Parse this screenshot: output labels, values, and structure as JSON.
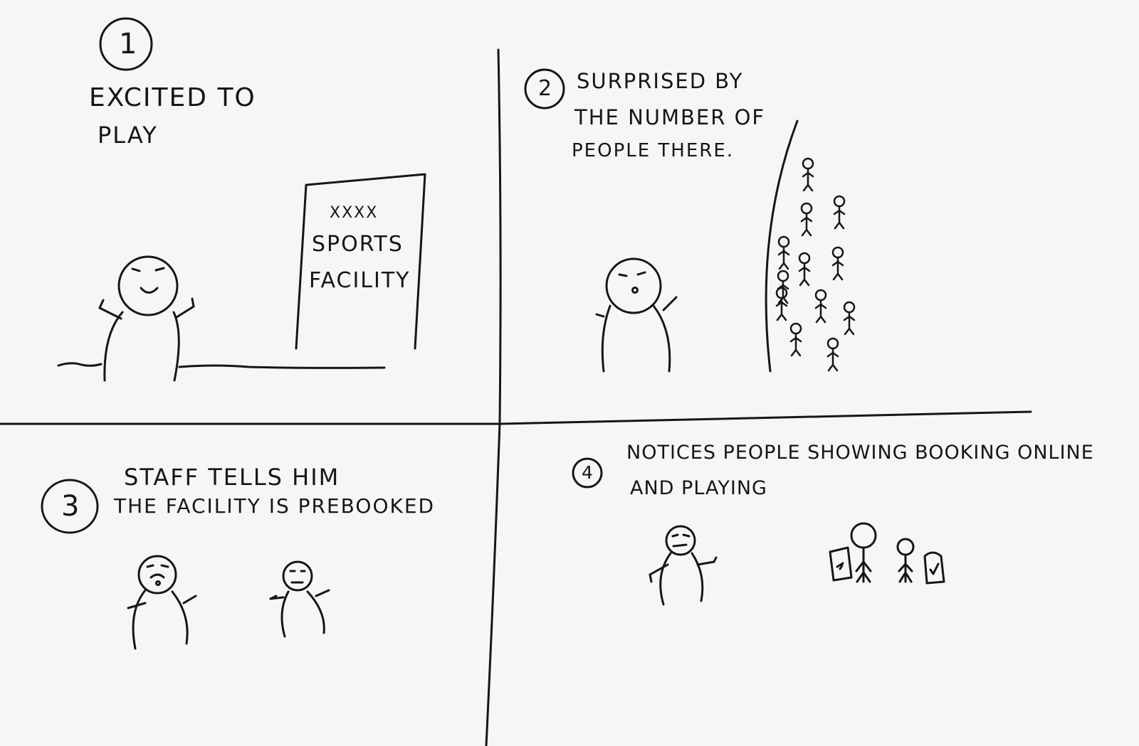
{
  "panels": [
    {
      "number": "1",
      "caption_lines": [
        "EXCITED TO",
        "PLAY"
      ]
    },
    {
      "number": "2",
      "caption_lines": [
        "SURPRISED BY",
        "THE NUMBER OF",
        "PEOPLE THERE."
      ]
    },
    {
      "number": "3",
      "caption_lines": [
        "STAFF TELLS HIM",
        "THE FACILITY IS PREBOOKED"
      ]
    },
    {
      "number": "4",
      "caption_lines": [
        "NOTICES PEOPLE SHOWING BOOKING ONLINE",
        "AND PLAYING"
      ]
    }
  ],
  "sign": {
    "line1": "XXXX",
    "line2": "SPORTS",
    "line3": "FACILITY"
  },
  "colors": {
    "paper": "#f6f6f4",
    "ink": "#161616"
  }
}
